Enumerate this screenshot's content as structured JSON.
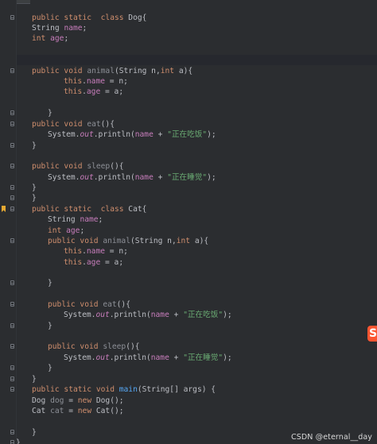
{
  "editor": {
    "lines": [
      {
        "id": "l1",
        "tokens": [
          [
            "kw",
            "public static  class "
          ],
          [
            "plain",
            "Dog{"
          ]
        ]
      },
      {
        "id": "l2",
        "tokens": [
          [
            "plain",
            "String "
          ],
          [
            "fld",
            "name"
          ],
          [
            "plain",
            ";"
          ]
        ]
      },
      {
        "id": "l3",
        "tokens": [
          [
            "kw",
            "int "
          ],
          [
            "fld",
            "age"
          ],
          [
            "plain",
            ";"
          ]
        ]
      },
      {
        "id": "l4",
        "tokens": [
          [
            "kw",
            "public void "
          ],
          [
            "gray",
            "animal"
          ],
          [
            "plain",
            "(String n,"
          ],
          [
            "kw",
            "int "
          ],
          [
            "plain",
            "a){"
          ]
        ]
      },
      {
        "id": "l5",
        "tokens": [
          [
            "kw",
            "this"
          ],
          [
            "plain",
            "."
          ],
          [
            "fld",
            "name"
          ],
          [
            "plain",
            " = n;"
          ]
        ]
      },
      {
        "id": "l6",
        "tokens": [
          [
            "kw",
            "this"
          ],
          [
            "plain",
            "."
          ],
          [
            "fld",
            "age"
          ],
          [
            "plain",
            " = a;"
          ]
        ]
      },
      {
        "id": "l7",
        "tokens": [
          [
            "plain",
            "}"
          ]
        ]
      },
      {
        "id": "l8",
        "tokens": [
          [
            "kw",
            "public void "
          ],
          [
            "gray",
            "eat"
          ],
          [
            "plain",
            "(){"
          ]
        ]
      },
      {
        "id": "l9",
        "tokens": [
          [
            "plain",
            "System."
          ],
          [
            "stat",
            "out"
          ],
          [
            "plain",
            ".println("
          ],
          [
            "fld",
            "name"
          ],
          [
            "plain",
            " + "
          ],
          [
            "str",
            "\"正在吃饭\""
          ],
          [
            "plain",
            ");"
          ]
        ]
      },
      {
        "id": "l10",
        "tokens": [
          [
            "plain",
            "}"
          ]
        ]
      },
      {
        "id": "l11",
        "tokens": [
          [
            "kw",
            "public void "
          ],
          [
            "gray",
            "sleep"
          ],
          [
            "plain",
            "(){"
          ]
        ]
      },
      {
        "id": "l12",
        "tokens": [
          [
            "plain",
            "System."
          ],
          [
            "stat",
            "out"
          ],
          [
            "plain",
            ".println("
          ],
          [
            "fld",
            "name"
          ],
          [
            "plain",
            " + "
          ],
          [
            "str",
            "\"正在睡觉\""
          ],
          [
            "plain",
            ");"
          ]
        ]
      },
      {
        "id": "l13",
        "tokens": [
          [
            "plain",
            "}"
          ]
        ]
      },
      {
        "id": "l14",
        "tokens": [
          [
            "plain",
            "}"
          ]
        ]
      },
      {
        "id": "l15",
        "tokens": [
          [
            "kw",
            "public static  class "
          ],
          [
            "plain",
            "Cat{"
          ]
        ]
      },
      {
        "id": "l16",
        "tokens": [
          [
            "plain",
            "String "
          ],
          [
            "fld",
            "name"
          ],
          [
            "plain",
            ";"
          ]
        ]
      },
      {
        "id": "l17",
        "tokens": [
          [
            "kw",
            "int "
          ],
          [
            "fld",
            "age"
          ],
          [
            "plain",
            ";"
          ]
        ]
      },
      {
        "id": "l18",
        "tokens": [
          [
            "kw",
            "public void "
          ],
          [
            "gray",
            "animal"
          ],
          [
            "plain",
            "(String n,"
          ],
          [
            "kw",
            "int "
          ],
          [
            "plain",
            "a){"
          ]
        ]
      },
      {
        "id": "l19",
        "tokens": [
          [
            "kw",
            "this"
          ],
          [
            "plain",
            "."
          ],
          [
            "fld",
            "name"
          ],
          [
            "plain",
            " = n;"
          ]
        ]
      },
      {
        "id": "l20",
        "tokens": [
          [
            "kw",
            "this"
          ],
          [
            "plain",
            "."
          ],
          [
            "fld",
            "age"
          ],
          [
            "plain",
            " = a;"
          ]
        ]
      },
      {
        "id": "l21",
        "tokens": [
          [
            "plain",
            "}"
          ]
        ]
      },
      {
        "id": "l22",
        "tokens": [
          [
            "kw",
            "public void "
          ],
          [
            "gray",
            "eat"
          ],
          [
            "plain",
            "(){"
          ]
        ]
      },
      {
        "id": "l23",
        "tokens": [
          [
            "plain",
            "System."
          ],
          [
            "stat",
            "out"
          ],
          [
            "plain",
            ".println("
          ],
          [
            "fld",
            "name"
          ],
          [
            "plain",
            " + "
          ],
          [
            "str",
            "\"正在吃饭\""
          ],
          [
            "plain",
            ");"
          ]
        ]
      },
      {
        "id": "l24",
        "tokens": [
          [
            "plain",
            "}"
          ]
        ]
      },
      {
        "id": "l25",
        "tokens": [
          [
            "kw",
            "public void "
          ],
          [
            "gray",
            "sleep"
          ],
          [
            "plain",
            "(){"
          ]
        ]
      },
      {
        "id": "l26",
        "tokens": [
          [
            "plain",
            "System."
          ],
          [
            "stat",
            "out"
          ],
          [
            "plain",
            ".println("
          ],
          [
            "fld",
            "name"
          ],
          [
            "plain",
            " + "
          ],
          [
            "str",
            "\"正在睡觉\""
          ],
          [
            "plain",
            ");"
          ]
        ]
      },
      {
        "id": "l27",
        "tokens": [
          [
            "plain",
            "}"
          ]
        ]
      },
      {
        "id": "l28",
        "tokens": [
          [
            "plain",
            "}"
          ]
        ]
      },
      {
        "id": "l29",
        "tokens": [
          [
            "kw",
            "public static void "
          ],
          [
            "fn",
            "main"
          ],
          [
            "plain",
            "(String[] args) {"
          ]
        ]
      },
      {
        "id": "l30",
        "tokens": [
          [
            "plain",
            "Dog "
          ],
          [
            "gray",
            "dog"
          ],
          [
            "plain",
            " = "
          ],
          [
            "kw",
            "new "
          ],
          [
            "plain",
            "Dog();"
          ]
        ]
      },
      {
        "id": "l31",
        "tokens": [
          [
            "plain",
            "Cat "
          ],
          [
            "gray",
            "cat"
          ],
          [
            "plain",
            " = "
          ],
          [
            "kw",
            "new "
          ],
          [
            "plain",
            "Cat();"
          ]
        ]
      },
      {
        "id": "l32",
        "tokens": [
          [
            "plain",
            "}"
          ]
        ]
      },
      {
        "id": "l33",
        "tokens": [
          [
            "plain",
            "}"
          ]
        ]
      }
    ]
  },
  "icons": {
    "fold": "fold-marker-icon",
    "bookmark": "bookmark-icon",
    "badge": "csdn-logo-icon"
  },
  "badge": {
    "letter": "S"
  },
  "watermark": {
    "text": "CSDN @eternal__day"
  },
  "colors": {
    "background": "#2b2d30",
    "keyword": "#cf8e6d",
    "field": "#c77dbb",
    "string": "#6aab73",
    "method_decl": "#56a8f5",
    "unused": "#8c8f96",
    "text": "#bcbec4",
    "bookmark": "#e5a832",
    "csdn": "#fc5531"
  }
}
